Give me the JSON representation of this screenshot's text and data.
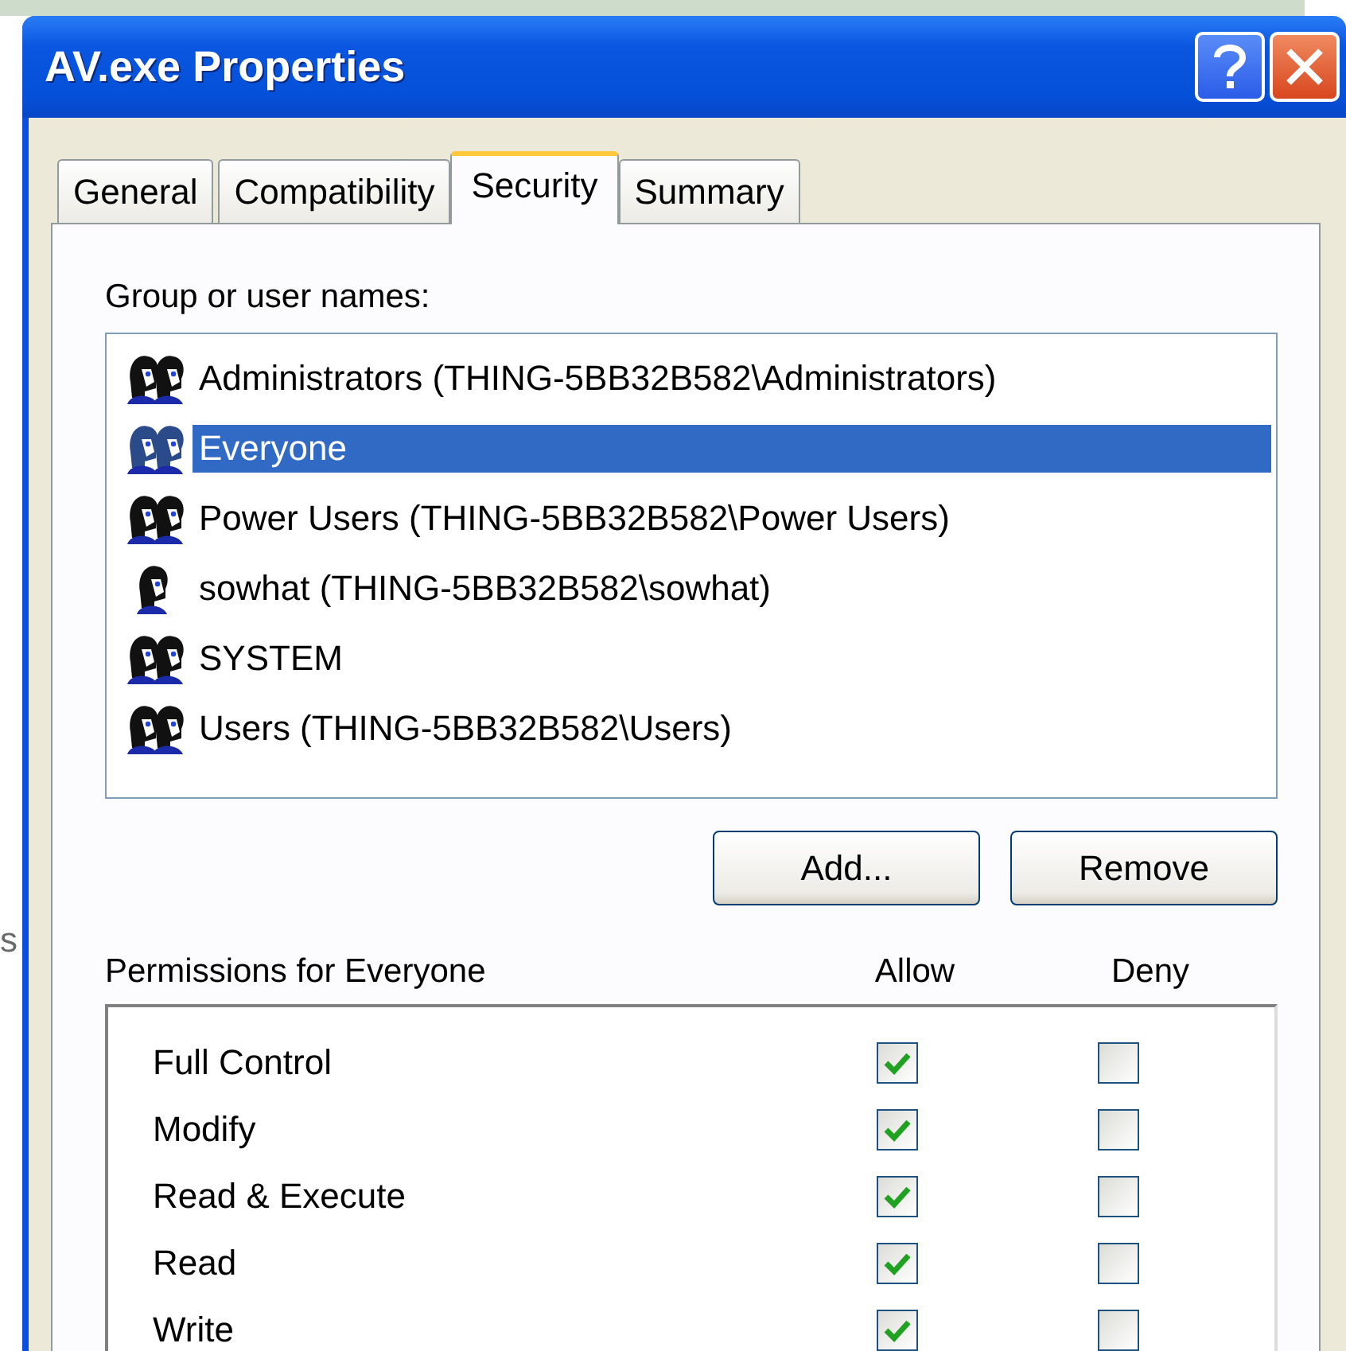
{
  "background_text": "s",
  "window": {
    "title": "AV.exe Properties"
  },
  "tabs": [
    {
      "label": "General",
      "selected": false
    },
    {
      "label": "Compatibility",
      "selected": false
    },
    {
      "label": "Security",
      "selected": true
    },
    {
      "label": "Summary",
      "selected": false
    }
  ],
  "names": {
    "label": "Group or user names:",
    "items": [
      {
        "kind": "group",
        "name": "Administrators (THING-5BB32B582\\Administrators)",
        "selected": false
      },
      {
        "kind": "group",
        "name": "Everyone",
        "selected": true
      },
      {
        "kind": "group",
        "name": "Power Users (THING-5BB32B582\\Power Users)",
        "selected": false
      },
      {
        "kind": "user",
        "name": "sowhat (THING-5BB32B582\\sowhat)",
        "selected": false
      },
      {
        "kind": "group",
        "name": "SYSTEM",
        "selected": false
      },
      {
        "kind": "group",
        "name": "Users (THING-5BB32B582\\Users)",
        "selected": false
      }
    ]
  },
  "buttons": [
    "Add...",
    "Remove"
  ],
  "permissions": {
    "label": "Permissions for Everyone",
    "allow_header": "Allow",
    "deny_header": "Deny",
    "rows": [
      {
        "name": "Full Control",
        "allow": true,
        "deny": false
      },
      {
        "name": "Modify",
        "allow": true,
        "deny": false
      },
      {
        "name": "Read & Execute",
        "allow": true,
        "deny": false
      },
      {
        "name": "Read",
        "allow": true,
        "deny": false
      },
      {
        "name": "Write",
        "allow": true,
        "deny": false
      }
    ]
  }
}
